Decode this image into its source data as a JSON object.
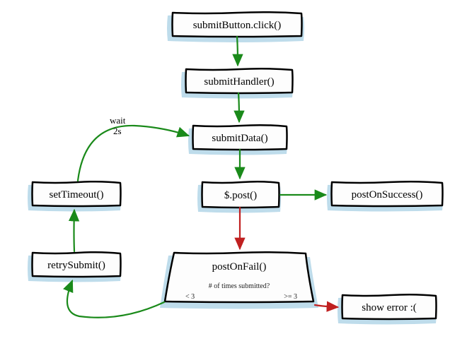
{
  "nodes": {
    "click": {
      "label": "submitButton.click()"
    },
    "handler": {
      "label": "submitHandler()"
    },
    "data": {
      "label": "submitData()"
    },
    "post": {
      "label": "$.post()"
    },
    "success": {
      "label": "postOnSuccess()"
    },
    "fail": {
      "label": "postOnFail()",
      "question": "# of times submitted?",
      "left": "< 3",
      "right": ">= 3"
    },
    "error": {
      "label": "show error :("
    },
    "retry": {
      "label": "retrySubmit()"
    },
    "timeout": {
      "label": "setTimeout()"
    }
  },
  "edge_label": {
    "wait": "wait\n2s"
  },
  "colors": {
    "box_bg": "#bedceb",
    "box_fg": "#fdfdfd",
    "edge_ok": "#1a8a1a",
    "edge_err": "#c02020"
  }
}
